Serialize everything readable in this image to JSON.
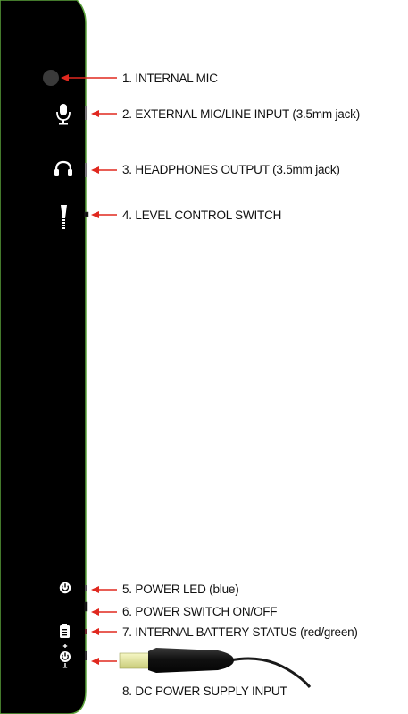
{
  "device": {
    "body_color": "#000000",
    "edge_color": "#5aa33a",
    "arrow_color": "#e0281f",
    "icon_color": "#ffffff"
  },
  "callouts": [
    {
      "label": "1. INTERNAL MIC",
      "icon": "internal-mic-hole-icon"
    },
    {
      "label": "2. EXTERNAL MIC/LINE INPUT (3.5mm jack)",
      "icon": "microphone-icon"
    },
    {
      "label": "3. HEADPHONES OUTPUT (3.5mm jack)",
      "icon": "headphones-icon"
    },
    {
      "label": "4. LEVEL CONTROL SWITCH",
      "icon": "level-switch-icon"
    },
    {
      "label": "5. POWER LED (blue)",
      "icon": "power-icon"
    },
    {
      "label": "6. POWER SWITCH ON/OFF",
      "icon": "power-switch-icon"
    },
    {
      "label": "7. INTERNAL BATTERY STATUS (red/green)",
      "icon": "battery-icon"
    },
    {
      "label": "8. DC POWER SUPPLY INPUT",
      "icon": "dc-input-icon"
    }
  ]
}
